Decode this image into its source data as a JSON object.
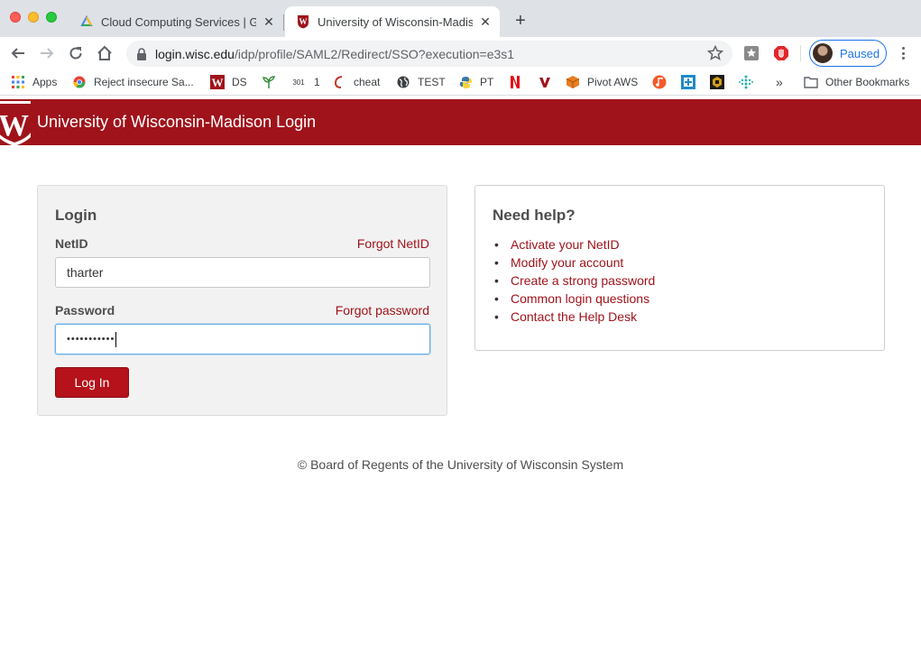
{
  "browser": {
    "tabs": [
      {
        "title": "Cloud Computing Services  |  Go",
        "icon": "google-cloud-icon",
        "active": false
      },
      {
        "title": "University of Wisconsin-Madison",
        "icon": "uw-crest-icon",
        "active": true
      }
    ],
    "url_host": "login.wisc.edu",
    "url_path": "/idp/profile/SAML2/Redirect/SSO?execution=e3s1",
    "profile_label": "Paused",
    "bookmarks": [
      {
        "label": "Apps",
        "icon": "apps-grid-icon"
      },
      {
        "label": "Reject insecure Sa...",
        "icon": "chrome-icon"
      },
      {
        "label": "DS",
        "icon": "uw-w-icon"
      },
      {
        "label": "",
        "icon": "sprout-icon"
      },
      {
        "label": "1",
        "icon": "301-icon",
        "icon_text": "301"
      },
      {
        "label": "cheat",
        "icon": "swirl-icon"
      },
      {
        "label": "TEST",
        "icon": "globe-icon"
      },
      {
        "label": "PT",
        "icon": "python-icon"
      },
      {
        "label": "",
        "icon": "netflix-icon"
      },
      {
        "label": "",
        "icon": "v-icon"
      },
      {
        "label": "Pivot AWS",
        "icon": "cube-icon"
      },
      {
        "label": "",
        "icon": "music-icon"
      },
      {
        "label": "",
        "icon": "blue-square-icon"
      },
      {
        "label": "",
        "icon": "badge-icon"
      },
      {
        "label": "",
        "icon": "dots-icon"
      }
    ],
    "overflow_label": "»",
    "other_bookmarks_label": "Other Bookmarks"
  },
  "colors": {
    "brand": "#a0131b",
    "button": "#b5121b",
    "link": "#a0131b"
  },
  "header": {
    "title": "University of Wisconsin-Madison Login"
  },
  "login": {
    "heading": "Login",
    "netid_label": "NetID",
    "forgot_netid": "Forgot NetID",
    "netid_value": "tharter",
    "password_label": "Password",
    "forgot_password": "Forgot password",
    "password_mask": "•••••••••••",
    "submit_label": "Log In"
  },
  "help": {
    "heading": "Need help?",
    "links": [
      "Activate your NetID",
      "Modify your account",
      "Create a strong password",
      "Common login questions",
      "Contact the Help Desk"
    ]
  },
  "footer": {
    "text": "© Board of Regents of the University of Wisconsin System"
  }
}
